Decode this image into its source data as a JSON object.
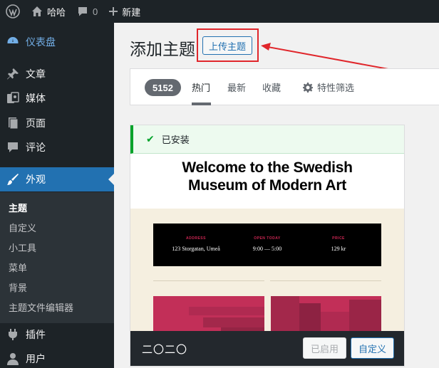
{
  "admin_bar": {
    "site_name": "哈哈",
    "comment_count": "0",
    "new_label": "新建"
  },
  "sidebar": {
    "items": [
      {
        "label": "仪表盘",
        "icon": "dashboard-icon"
      },
      {
        "label": "文章",
        "icon": "pushpin-icon"
      },
      {
        "label": "媒体",
        "icon": "media-icon"
      },
      {
        "label": "页面",
        "icon": "page-icon"
      },
      {
        "label": "评论",
        "icon": "comment-icon"
      },
      {
        "label": "外观",
        "icon": "paintbrush-icon"
      },
      {
        "label": "插件",
        "icon": "plugin-icon"
      },
      {
        "label": "用户",
        "icon": "user-icon"
      }
    ],
    "submenu": [
      {
        "label": "主题"
      },
      {
        "label": "自定义"
      },
      {
        "label": "小工具"
      },
      {
        "label": "菜单"
      },
      {
        "label": "背景"
      },
      {
        "label": "主题文件编辑器"
      }
    ]
  },
  "page": {
    "title": "添加主题",
    "upload_button": "上传主题"
  },
  "filter_bar": {
    "count": "5152",
    "tabs": [
      {
        "label": "热门"
      },
      {
        "label": "最新"
      },
      {
        "label": "收藏"
      }
    ],
    "feature_filter": "特性筛选"
  },
  "theme_card": {
    "notice": "已安装",
    "screenshot": {
      "title_line1": "Welcome to the Swedish",
      "title_line2": "Museum of Modern Art",
      "info": [
        {
          "label": "ADDRESS",
          "value": "123 Storgatan, Umeå"
        },
        {
          "label": "OPEN TODAY",
          "value": "9:00 — 5:00"
        },
        {
          "label": "PRICE",
          "value": "129 kr"
        }
      ]
    },
    "name": "二〇二〇",
    "activated_button": "已启用",
    "customize_button": "自定义"
  },
  "colors": {
    "admin_bg": "#1d2327",
    "active_menu": "#2271b1",
    "highlight": "#e0262b",
    "installed_green": "#00a32a",
    "theme_accent": "#cd2653"
  }
}
